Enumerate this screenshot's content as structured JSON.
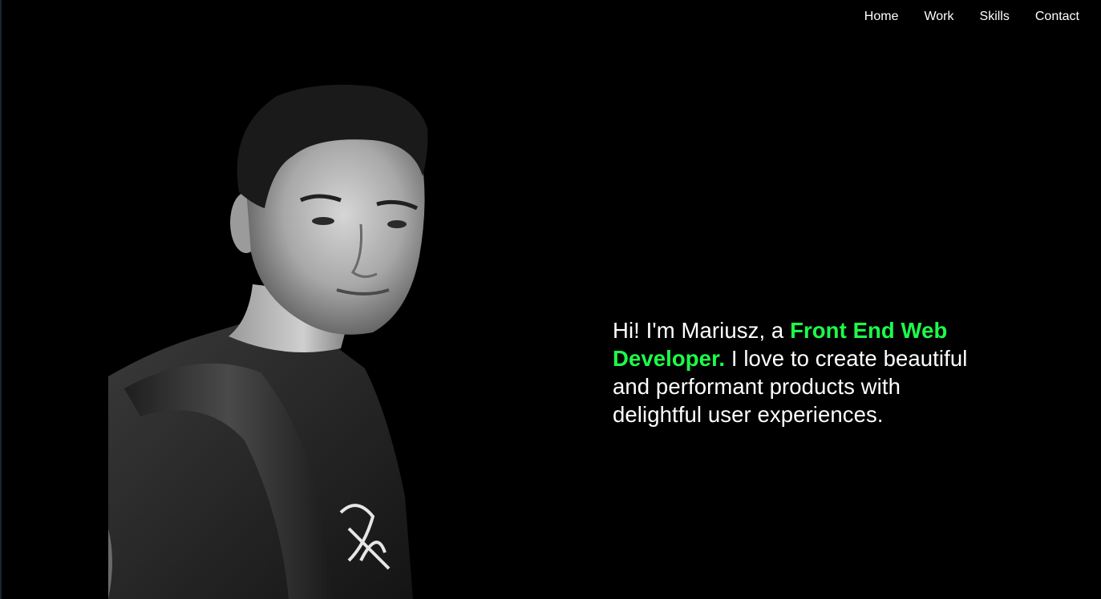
{
  "nav": {
    "items": [
      {
        "label": "Home"
      },
      {
        "label": "Work"
      },
      {
        "label": "Skills"
      },
      {
        "label": "Contact"
      }
    ]
  },
  "hero": {
    "intro": "Hi! I'm Mariusz, a ",
    "highlight": "Front End Web Developer.",
    "rest": " I love to create beautiful and performant products with delightful user experiences."
  },
  "colors": {
    "background": "#000000",
    "text": "#ffffff",
    "accent": "#1cff4a"
  }
}
